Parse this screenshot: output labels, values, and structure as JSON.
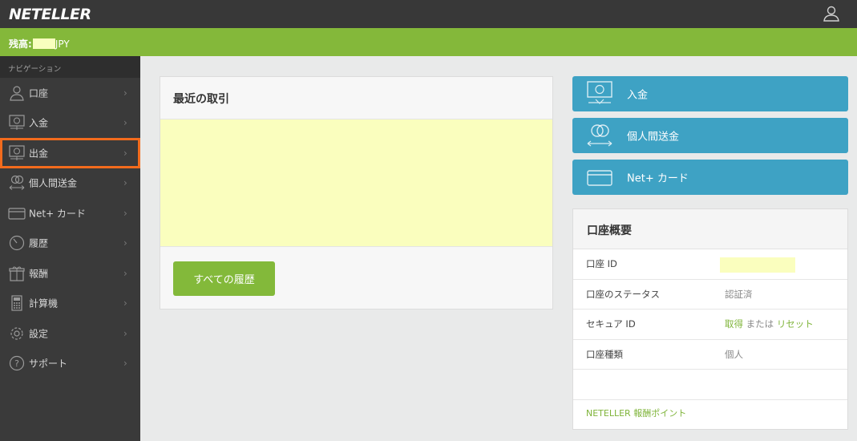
{
  "header": {
    "logo": "NETELLER",
    "user_icon": "user-icon"
  },
  "balance": {
    "label": "残高:",
    "currency": "JPY"
  },
  "sidebar": {
    "heading": "ナビゲーション",
    "items": [
      {
        "label": "口座",
        "icon": "user-icon"
      },
      {
        "label": "入金",
        "icon": "deposit-icon"
      },
      {
        "label": "出金",
        "icon": "withdraw-icon"
      },
      {
        "label": "個人間送金",
        "icon": "transfer-icon"
      },
      {
        "label": "Net+ カード",
        "icon": "card-icon"
      },
      {
        "label": "履歴",
        "icon": "history-icon"
      },
      {
        "label": "報酬",
        "icon": "gift-icon"
      },
      {
        "label": "計算機",
        "icon": "calculator-icon"
      },
      {
        "label": "設定",
        "icon": "gear-icon"
      },
      {
        "label": "サポート",
        "icon": "help-icon"
      }
    ],
    "chevron": "›"
  },
  "recent": {
    "title": "最近の取引",
    "all_history_button": "すべての履歴"
  },
  "actions": [
    {
      "label": "入金",
      "icon": "deposit-icon"
    },
    {
      "label": "個人間送金",
      "icon": "transfer-icon"
    },
    {
      "label": "Net+ カード",
      "icon": "card-icon"
    }
  ],
  "summary": {
    "title": "口座概要",
    "rows": {
      "account_id": {
        "label": "口座 ID"
      },
      "status": {
        "label": "口座のステータス",
        "value": "認証済"
      },
      "secure_id": {
        "label": "セキュア ID",
        "get": "取得",
        "or": " または ",
        "reset": "リセット"
      },
      "type": {
        "label": "口座種類",
        "value": "個人"
      }
    },
    "points_link": "NETELLER 報酬ポイント"
  },
  "colors": {
    "topbar": "#383838",
    "brand_green": "#84b83a",
    "action_blue": "#3ea2c4",
    "highlight_orange": "#f26b1d",
    "masked_yellow": "#fafebe"
  }
}
